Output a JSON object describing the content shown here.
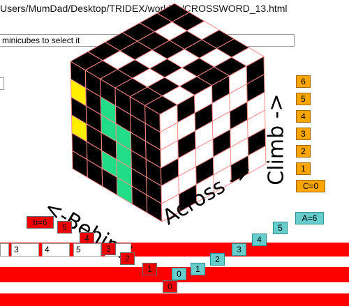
{
  "address_path": "Users/MumDad/Desktop/TRIDEX/working/CROSSWORD_13.html",
  "instruction": "minicubes to select it",
  "axis_labels": {
    "climb": "Climb ->",
    "across": "Across ->",
    "behind": "<-Behind"
  },
  "climb_buttons": [
    "6",
    "5",
    "4",
    "3",
    "2",
    "1"
  ],
  "climb_origin": "C=0",
  "across_buttons": [
    "0",
    "1",
    "2",
    "3",
    "4",
    "5"
  ],
  "across_origin": "A=6",
  "behind_buttons": [
    "0",
    "1",
    "2",
    "3",
    "4",
    "5"
  ],
  "behind_origin": "b=6",
  "position_fields": [
    "3",
    "4",
    "5"
  ],
  "colors": {
    "accent_orange": "#ffa500",
    "accent_teal": "#66cccc",
    "accent_red": "#ee0000",
    "cube_black": "#000000",
    "cube_white": "#ffffff",
    "highlight_green": "#22dd88",
    "highlight_yellow": "#ffee00",
    "grid_line": "#ff8888"
  },
  "cube": {
    "size": 6,
    "top": [
      "BBBBBB",
      "BWBBWB",
      "BBWBBW",
      "BWBWBB",
      "BBWBWB",
      "BWBBBW"
    ],
    "left": [
      "BBBBBB",
      "YBGBBB",
      "BBGGBB",
      "YBBGBB",
      "BBGGBB",
      "BBBGBB"
    ],
    "right": [
      "WBWBWB",
      "WWBWWB",
      "WBWWBW",
      "BWWBWW",
      "WWBWWB",
      "WBWWBW"
    ]
  }
}
